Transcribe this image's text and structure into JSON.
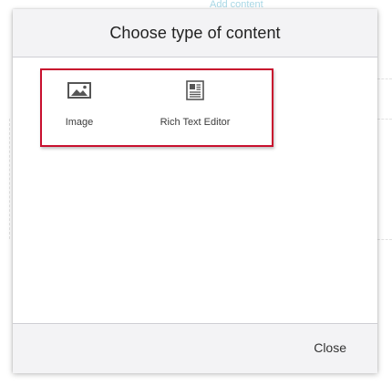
{
  "background": {
    "add_content_label": "Add content"
  },
  "dialog": {
    "title": "Choose type of content",
    "content_types": [
      {
        "label": "Image",
        "icon": "image-icon"
      },
      {
        "label": "Rich Text Editor",
        "icon": "rich-text-editor-icon"
      }
    ],
    "close_label": "Close"
  },
  "colors": {
    "highlight": "#c8102e",
    "header_bg": "#f3f3f5",
    "footer_bg": "#f3f3f5",
    "icon": "#555555"
  }
}
